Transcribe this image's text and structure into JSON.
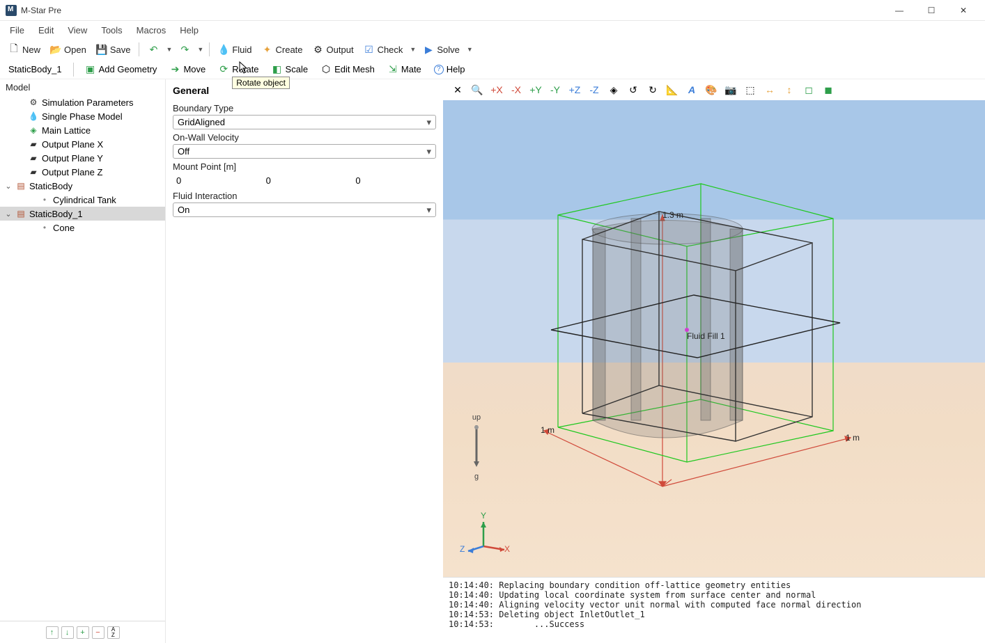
{
  "title": "M-Star Pre",
  "menu": [
    "File",
    "Edit",
    "View",
    "Tools",
    "Macros",
    "Help"
  ],
  "toolbar_main": {
    "new": "New",
    "open": "Open",
    "save": "Save",
    "fluid": "Fluid",
    "create": "Create",
    "output": "Output",
    "check": "Check",
    "solve": "Solve"
  },
  "context": {
    "active": "StaticBody_1",
    "add_geometry": "Add Geometry",
    "move": "Move",
    "rotate": "Rotate",
    "scale": "Scale",
    "edit_mesh": "Edit Mesh",
    "mate": "Mate",
    "help": "Help",
    "tooltip": "Rotate object"
  },
  "tree": {
    "header": "Model",
    "items": [
      {
        "label": "Simulation Parameters",
        "icon": "gear"
      },
      {
        "label": "Single Phase Model",
        "icon": "drop"
      },
      {
        "label": "Main Lattice",
        "icon": "cube-green"
      },
      {
        "label": "Output Plane X",
        "icon": "plane"
      },
      {
        "label": "Output Plane Y",
        "icon": "plane"
      },
      {
        "label": "Output Plane Z",
        "icon": "plane"
      },
      {
        "label": "StaticBody",
        "icon": "brick",
        "expandable": true,
        "expanded": true
      },
      {
        "label": "Cylindrical Tank",
        "icon": "dot",
        "indent": 2
      },
      {
        "label": "StaticBody_1",
        "icon": "brick",
        "expandable": true,
        "expanded": true,
        "selected": true
      },
      {
        "label": "Cone",
        "icon": "dot",
        "indent": 2
      }
    ]
  },
  "properties": {
    "heading": "General",
    "boundary_type_label": "Boundary Type",
    "boundary_type_value": "GridAligned",
    "on_wall_label": "On-Wall Velocity",
    "on_wall_value": "Off",
    "mount_label": "Mount Point [m]",
    "mount": [
      "0",
      "0",
      "0"
    ],
    "fluid_interaction_label": "Fluid Interaction",
    "fluid_interaction_value": "On"
  },
  "viewport": {
    "fluid_fill_label": "Fluid Fill 1",
    "up_label": "up",
    "g_label": "g",
    "y_axis": "Y",
    "x_axis": "X",
    "z_axis": "Z",
    "dim_left": "1 m",
    "dim_right": "1 m",
    "dim_top": "1.3 m"
  },
  "console_lines": [
    "10:14:40: Replacing boundary condition off-lattice geometry entities",
    "10:14:40: Updating local coordinate system from surface center and normal",
    "10:14:40: Aligning velocity vector unit normal with computed face normal direction",
    "10:14:53: Deleting object InletOutlet_1",
    "10:14:53:        ...Success"
  ]
}
